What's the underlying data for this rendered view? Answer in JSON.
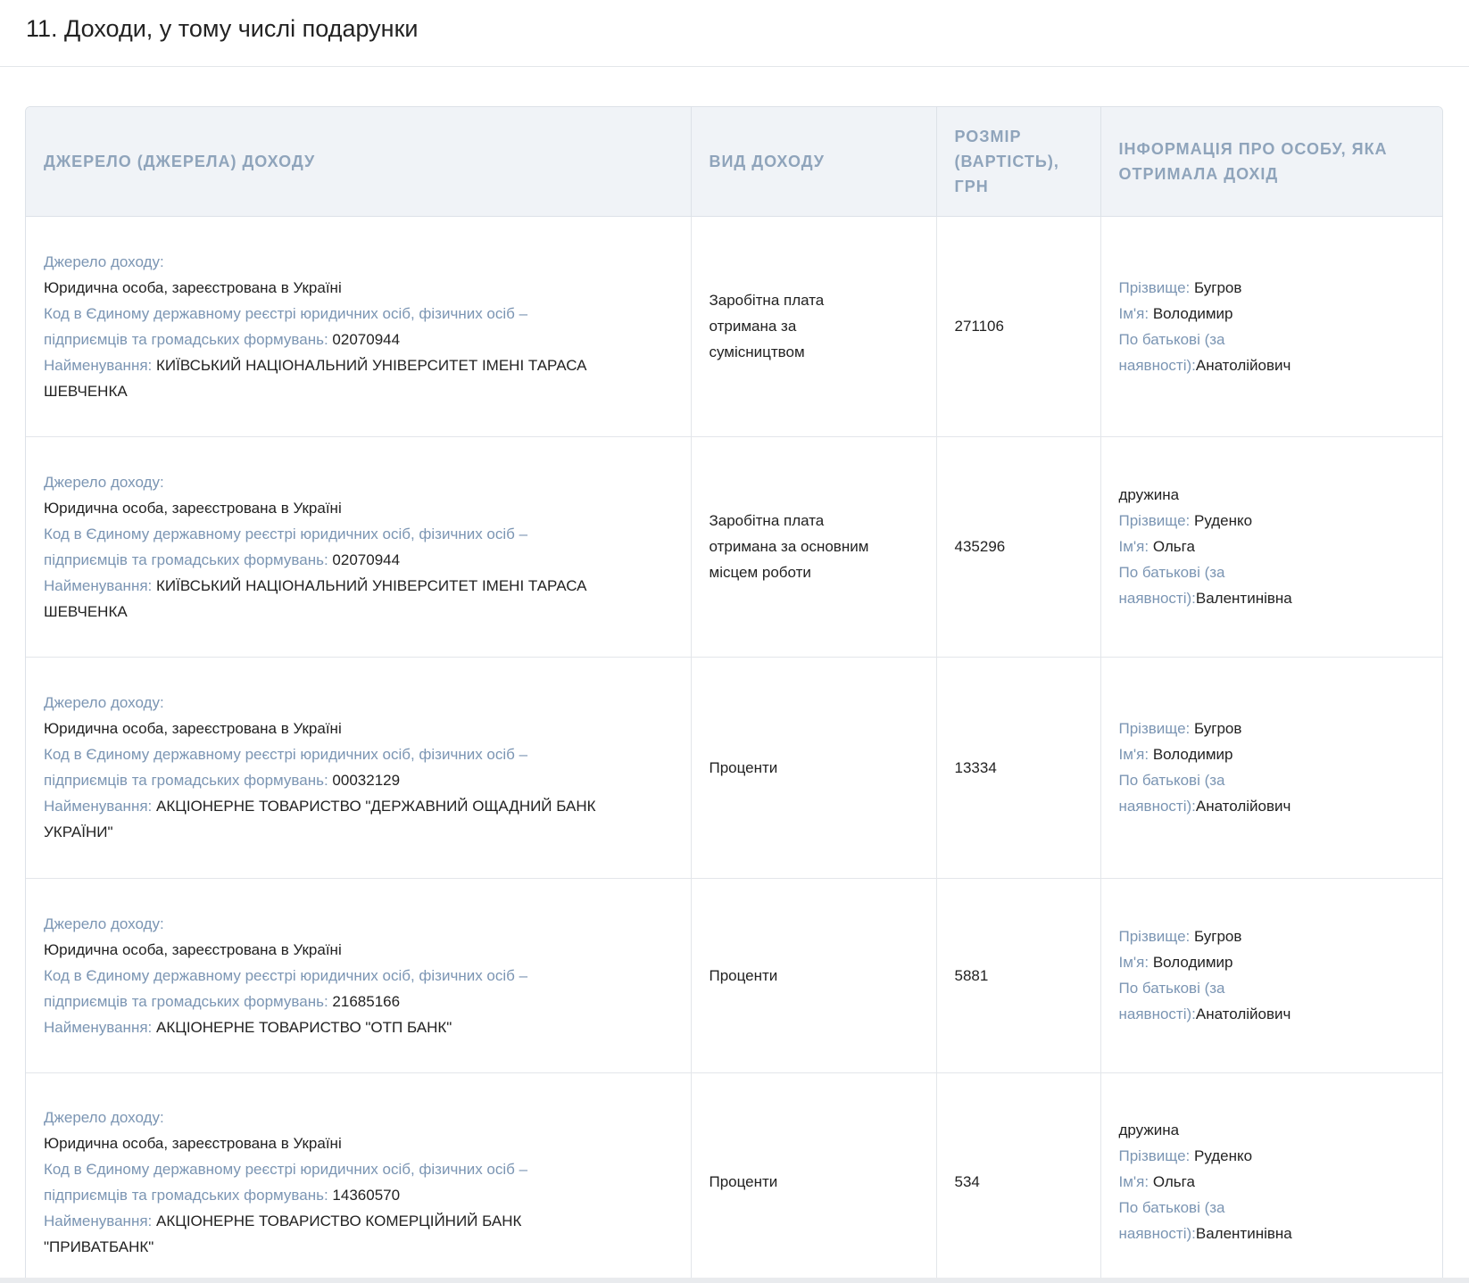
{
  "section": {
    "title": "11. Доходи, у тому числі подарунки"
  },
  "table": {
    "headers": {
      "source": "Джерело (джерела) доходу",
      "income_type": "Вид доходу",
      "amount_line1": "Розмір",
      "amount_line2": "(вартість),",
      "amount_line3": "грн",
      "person": "Інформація про особу, яка отримала дохід"
    },
    "labels": {
      "source": "Джерело доходу:",
      "code_line1": "Код в Єдиному державному реєстрі юридичних осіб, фізичних осіб –",
      "code_line2": "підприємців та громадських формувань:",
      "name": "Найменування:",
      "surname": "Прізвище:",
      "first_name": "Ім'я:",
      "patronymic_line1": "По батькові (за",
      "patronymic_line2": "наявності):"
    },
    "rows": [
      {
        "source_type": "Юридична особа, зареєстрована в Україні",
        "code": "02070944",
        "name_line1": "КИЇВСЬКИЙ НАЦІОНАЛЬНИЙ УНІВЕРСИТЕТ ІМЕНІ ТАРАСА",
        "name_line2": "ШЕВЧЕНКА",
        "income_type_lines": [
          "Заробітна плата",
          "отримана за",
          "сумісництвом"
        ],
        "amount": "271106",
        "relation": "",
        "surname": "Бугров",
        "first_name": "Володимир",
        "patronymic": "Анатолійович"
      },
      {
        "source_type": "Юридична особа, зареєстрована в Україні",
        "code": "02070944",
        "name_line1": "КИЇВСЬКИЙ НАЦІОНАЛЬНИЙ УНІВЕРСИТЕТ ІМЕНІ ТАРАСА",
        "name_line2": "ШЕВЧЕНКА",
        "income_type_lines": [
          "Заробітна плата",
          "отримана за основним",
          "місцем роботи"
        ],
        "amount": "435296",
        "relation": "дружина",
        "surname": "Руденко",
        "first_name": "Ольга",
        "patronymic": "Валентинівна"
      },
      {
        "source_type": "Юридична особа, зареєстрована в Україні",
        "code": "00032129",
        "name_line1": "АКЦІОНЕРНЕ ТОВАРИСТВО \"ДЕРЖАВНИЙ ОЩАДНИЙ БАНК",
        "name_line2": "УКРАЇНИ\"",
        "income_type_lines": [
          "Проценти"
        ],
        "amount": "13334",
        "relation": "",
        "surname": "Бугров",
        "first_name": "Володимир",
        "patronymic": "Анатолійович"
      },
      {
        "source_type": "Юридична особа, зареєстрована в Україні",
        "code": "21685166",
        "name_line1": "АКЦІОНЕРНЕ ТОВАРИСТВО \"ОТП БАНК\"",
        "name_line2": "",
        "income_type_lines": [
          "Проценти"
        ],
        "amount": "5881",
        "relation": "",
        "surname": "Бугров",
        "first_name": "Володимир",
        "patronymic": "Анатолійович"
      },
      {
        "source_type": "Юридична особа, зареєстрована в Україні",
        "code": "14360570",
        "name_line1": "АКЦІОНЕРНЕ ТОВАРИСТВО КОМЕРЦІЙНИЙ БАНК",
        "name_line2": "\"ПРИВАТБАНК\"",
        "income_type_lines": [
          "Проценти"
        ],
        "amount": "534",
        "relation": "дружина",
        "surname": "Руденко",
        "first_name": "Ольга",
        "patronymic": "Валентинівна"
      }
    ]
  }
}
